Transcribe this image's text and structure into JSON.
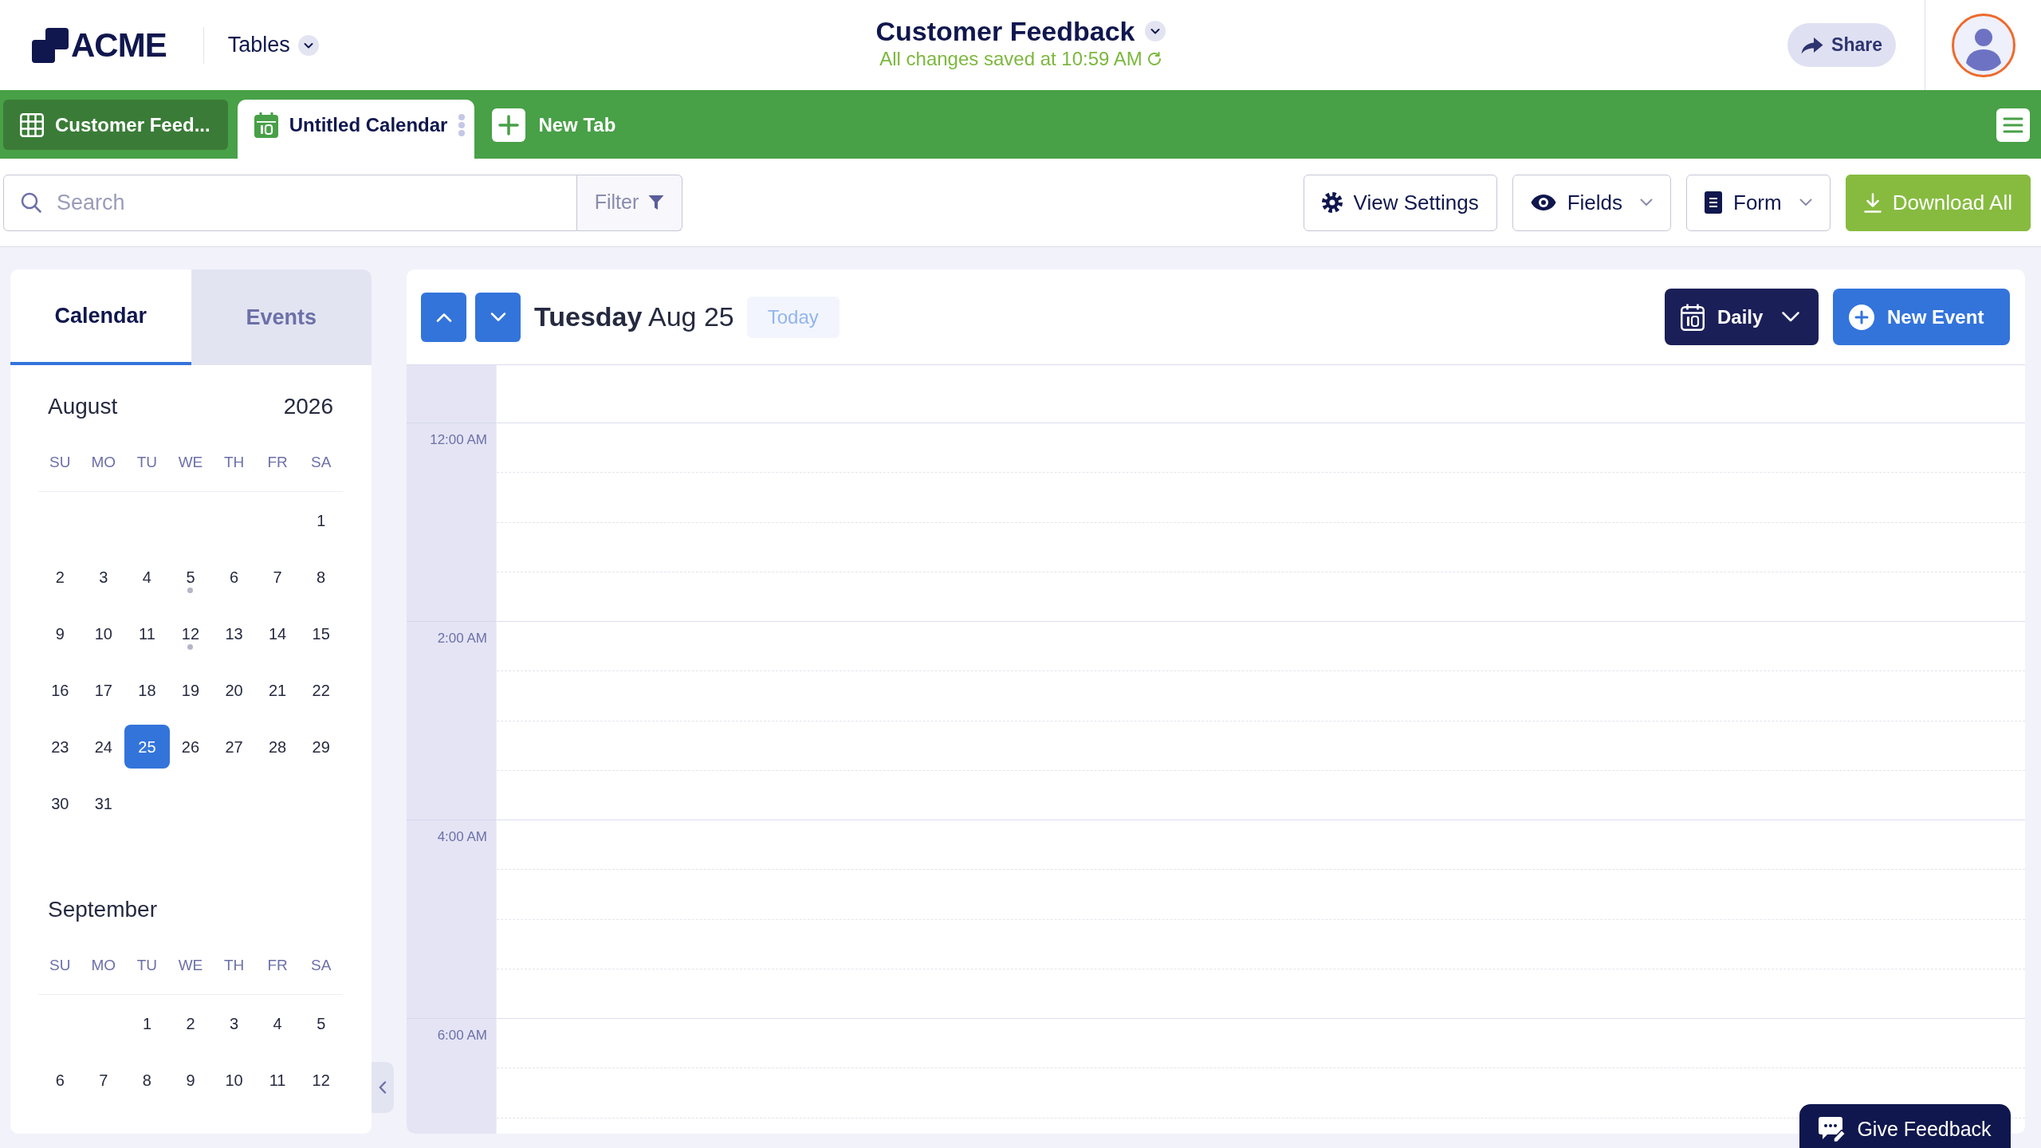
{
  "header": {
    "logo": "ACME",
    "section_menu": "Tables",
    "title": "Customer Feedback",
    "save_status": "All changes saved at 10:59 AM",
    "share_button": "Share"
  },
  "tabs": [
    {
      "label": "Customer Feed...",
      "kind": "table",
      "selected": false
    },
    {
      "label": "Untitled Calendar",
      "kind": "calendar",
      "selected": true
    }
  ],
  "new_tab_button": "New Tab",
  "toolbar": {
    "search": {
      "placeholder": "Search"
    },
    "filter": "Filter",
    "buttons": [
      {
        "label": "View Settings",
        "kind": "settings",
        "dropdown": false
      },
      {
        "label": "Fields",
        "kind": "fields",
        "dropdown": true
      },
      {
        "label": "Form",
        "kind": "form",
        "dropdown": true
      },
      {
        "label": "Download All",
        "kind": "download",
        "dropdown": false
      }
    ]
  },
  "sidebar": {
    "tabs": [
      {
        "label": "Calendar",
        "selected": true
      },
      {
        "label": "Events",
        "selected": false
      }
    ],
    "months": [
      {
        "name": "August",
        "year": "2026",
        "weekdays": [
          "SU",
          "MO",
          "TU",
          "WE",
          "TH",
          "FR",
          "SA"
        ],
        "weeks": [
          {
            "kind": "first",
            "days": [
              {
                "day": "1",
                "selected": false,
                "has_event": false
              }
            ]
          },
          {
            "kind": "full",
            "days": [
              {
                "day": "2",
                "selected": false,
                "has_event": false
              },
              {
                "day": "3",
                "selected": false,
                "has_event": false
              },
              {
                "day": "4",
                "selected": false,
                "has_event": false
              },
              {
                "day": "5",
                "selected": false,
                "has_event": true
              },
              {
                "day": "6",
                "selected": false,
                "has_event": false
              },
              {
                "day": "7",
                "selected": false,
                "has_event": false
              },
              {
                "day": "8",
                "selected": false,
                "has_event": false
              }
            ]
          },
          {
            "kind": "full",
            "days": [
              {
                "day": "9",
                "selected": false,
                "has_event": false
              },
              {
                "day": "10",
                "selected": false,
                "has_event": false
              },
              {
                "day": "11",
                "selected": false,
                "has_event": false
              },
              {
                "day": "12",
                "selected": false,
                "has_event": true
              },
              {
                "day": "13",
                "selected": false,
                "has_event": false
              },
              {
                "day": "14",
                "selected": false,
                "has_event": false
              },
              {
                "day": "15",
                "selected": false,
                "has_event": false
              }
            ]
          },
          {
            "kind": "full",
            "days": [
              {
                "day": "16",
                "selected": false,
                "has_event": false
              },
              {
                "day": "17",
                "selected": false,
                "has_event": false
              },
              {
                "day": "18",
                "selected": false,
                "has_event": false
              },
              {
                "day": "19",
                "selected": false,
                "has_event": false
              },
              {
                "day": "20",
                "selected": false,
                "has_event": false
              },
              {
                "day": "21",
                "selected": false,
                "has_event": false
              },
              {
                "day": "22",
                "selected": false,
                "has_event": false
              }
            ]
          },
          {
            "kind": "full",
            "days": [
              {
                "day": "23",
                "selected": false,
                "has_event": false
              },
              {
                "day": "24",
                "selected": false,
                "has_event": false
              },
              {
                "day": "25",
                "selected": true,
                "has_event": false
              },
              {
                "day": "26",
                "selected": false,
                "has_event": false
              },
              {
                "day": "27",
                "selected": false,
                "has_event": false
              },
              {
                "day": "28",
                "selected": false,
                "has_event": false
              },
              {
                "day": "29",
                "selected": false,
                "has_event": false
              }
            ]
          },
          {
            "kind": "last",
            "days": [
              {
                "day": "30",
                "selected": false,
                "has_event": false
              },
              {
                "day": "31",
                "selected": false,
                "has_event": false
              }
            ]
          }
        ]
      },
      {
        "name": "September",
        "weekdays": [
          "SU",
          "MO",
          "TU",
          "WE",
          "TH",
          "FR",
          "SA"
        ],
        "weeks": [
          {
            "kind": "first",
            "days": [
              {
                "day": "1",
                "selected": false,
                "has_event": false
              },
              {
                "day": "2",
                "selected": false,
                "has_event": false
              },
              {
                "day": "3",
                "selected": false,
                "has_event": false
              },
              {
                "day": "4",
                "selected": false,
                "has_event": false
              },
              {
                "day": "5",
                "selected": false,
                "has_event": false
              }
            ]
          },
          {
            "kind": "full",
            "days": [
              {
                "day": "6",
                "selected": false,
                "has_event": false
              },
              {
                "day": "7",
                "selected": false,
                "has_event": false
              },
              {
                "day": "8",
                "selected": false,
                "has_event": false
              },
              {
                "day": "9",
                "selected": false,
                "has_event": false
              },
              {
                "day": "10",
                "selected": false,
                "has_event": false
              },
              {
                "day": "11",
                "selected": false,
                "has_event": false
              },
              {
                "day": "12",
                "selected": false,
                "has_event": false
              }
            ]
          }
        ]
      }
    ]
  },
  "calendar": {
    "day_name": "Tuesday",
    "date": "Aug 25",
    "today_button": "Today",
    "view_menu": "Daily",
    "new_event_button": "New Event",
    "time_labels": [
      "12:00 AM",
      "2:00 AM",
      "4:00 AM",
      "6:00 AM"
    ]
  },
  "feedback_button": "Give Feedback"
}
